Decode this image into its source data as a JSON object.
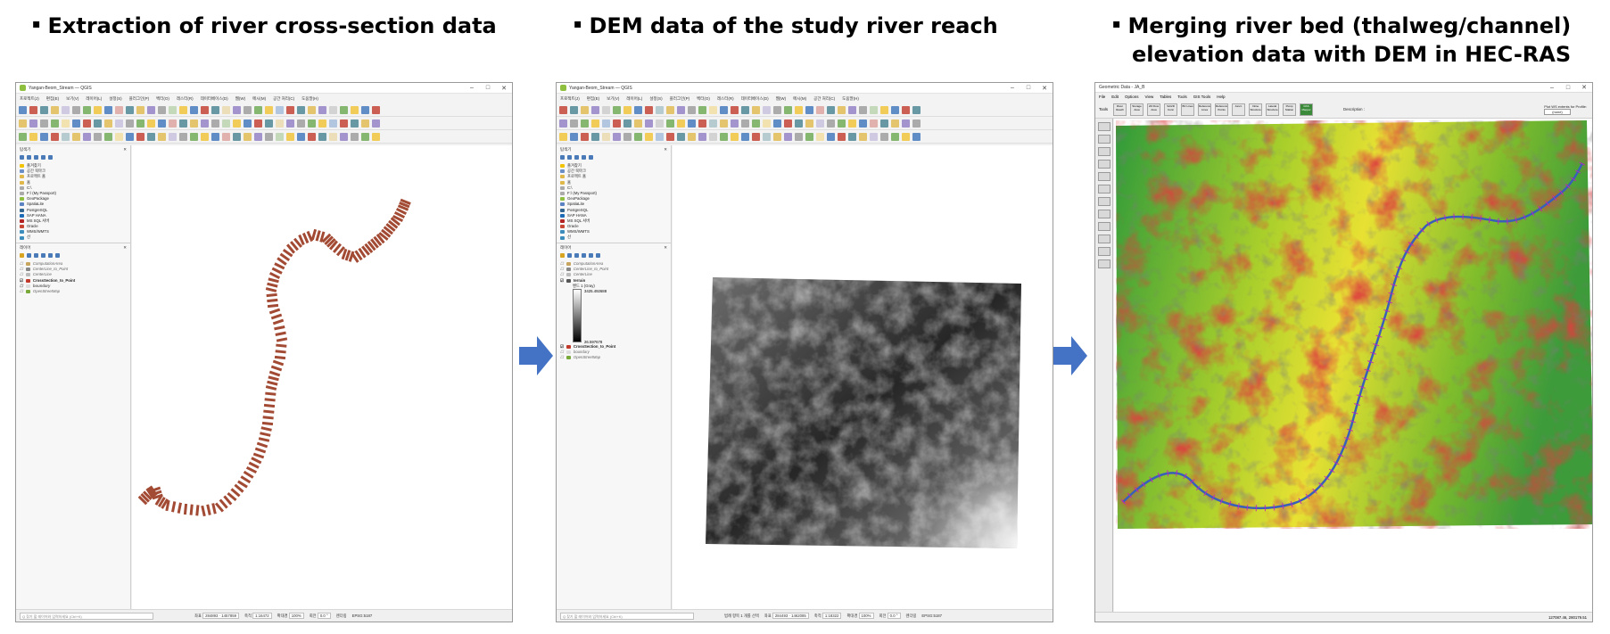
{
  "captions": {
    "left": "Extraction of river cross-section data",
    "middle": "DEM data of the study river reach",
    "right_line1": "Merging river bed (thalweg/channel)",
    "right_line2": "elevation data with DEM in HEC-RAS",
    "bullet": "▪"
  },
  "arrow_color": "#4472c4",
  "qgis": {
    "window_title": "Yangan-Beom_Stream — QGIS",
    "menu": [
      "프로젝트(J)",
      "편집(E)",
      "보기(V)",
      "레이어(L)",
      "설정(S)",
      "플러그인(P)",
      "벡터(O)",
      "래스터(R)",
      "데이터베이스(D)",
      "웹(W)",
      "메시(M)",
      "공간 처리(C)",
      "도움말(H)"
    ],
    "browser_title": "탐색기",
    "layers_title": "레이어",
    "browser_items": [
      "즐겨찾기",
      "공간 북마크",
      "프로젝트 홈",
      "홈",
      "C:\\",
      "F:\\ (My Passport)",
      "GeoPackage",
      "SpatiaLite",
      "PostgreSQL",
      "SAP HANA",
      "MS SQL 서버",
      "Oracle",
      "WMS/WMTS",
      "선"
    ],
    "layers_left": [
      "ComputationArea",
      "CenterLine_to_Point",
      "CenterLine",
      "CrossSection_to_Point",
      "boundary",
      "OpenStreetMap"
    ],
    "layers_mid": [
      "ComputationArea",
      "CenterLine_to_Point",
      "CenterLine",
      "terrain",
      "밴드 1 (Gray)",
      "3425.492688",
      "26.597678",
      "CrossSection_to_Point",
      "boundary",
      "OpenStreetMap"
    ],
    "status_search_placeholder": "Q 찾기 할 레이어와 입력하세요 (Ctrl+K)",
    "status_left": {
      "coord_label": "좌표",
      "coord": "284893 · 1457859",
      "scale_label": "축척",
      "scale": "1:16472",
      "mag_label": "확대경",
      "mag": "100%",
      "rot_label": "회전",
      "rot": "0.0 °",
      "render": "렌더링",
      "crs": "EPSG:5187"
    },
    "status_mid": {
      "extra": "범례 항목 1 개를 선택",
      "coord_label": "좌표",
      "coord": "284493 · 1462085",
      "scale_label": "축척",
      "scale": "1:18322",
      "mag_label": "확대경",
      "mag": "100%",
      "rot_label": "회전",
      "rot": "0.0 °",
      "render": "렌더링",
      "crs": "EPSG:5187"
    }
  },
  "hecras": {
    "window_title": "Geometric Data - JA_B",
    "menu": [
      "File",
      "Edit",
      "Options",
      "View",
      "Tables",
      "Tools",
      "GIS Tools",
      "Help"
    ],
    "tools_label": "Tools",
    "buttons": [
      "River Reach",
      "Storage Area",
      "2D Flow Area",
      "SA/2D Conn",
      "BC Lines",
      "Reference Lines",
      "Reference Points",
      "Junct.",
      "Cross Section",
      "Brdg/Culv",
      "Inline Structure",
      "Lateral Structure",
      "Storage Area",
      "2D Flow Area",
      "Pump Station",
      "RAS Mapper"
    ],
    "description_label": "Description :",
    "plot_label": "Plot WS extents for Profile:",
    "plot_value": "(none)",
    "status": "127087.46, 280179.51"
  }
}
